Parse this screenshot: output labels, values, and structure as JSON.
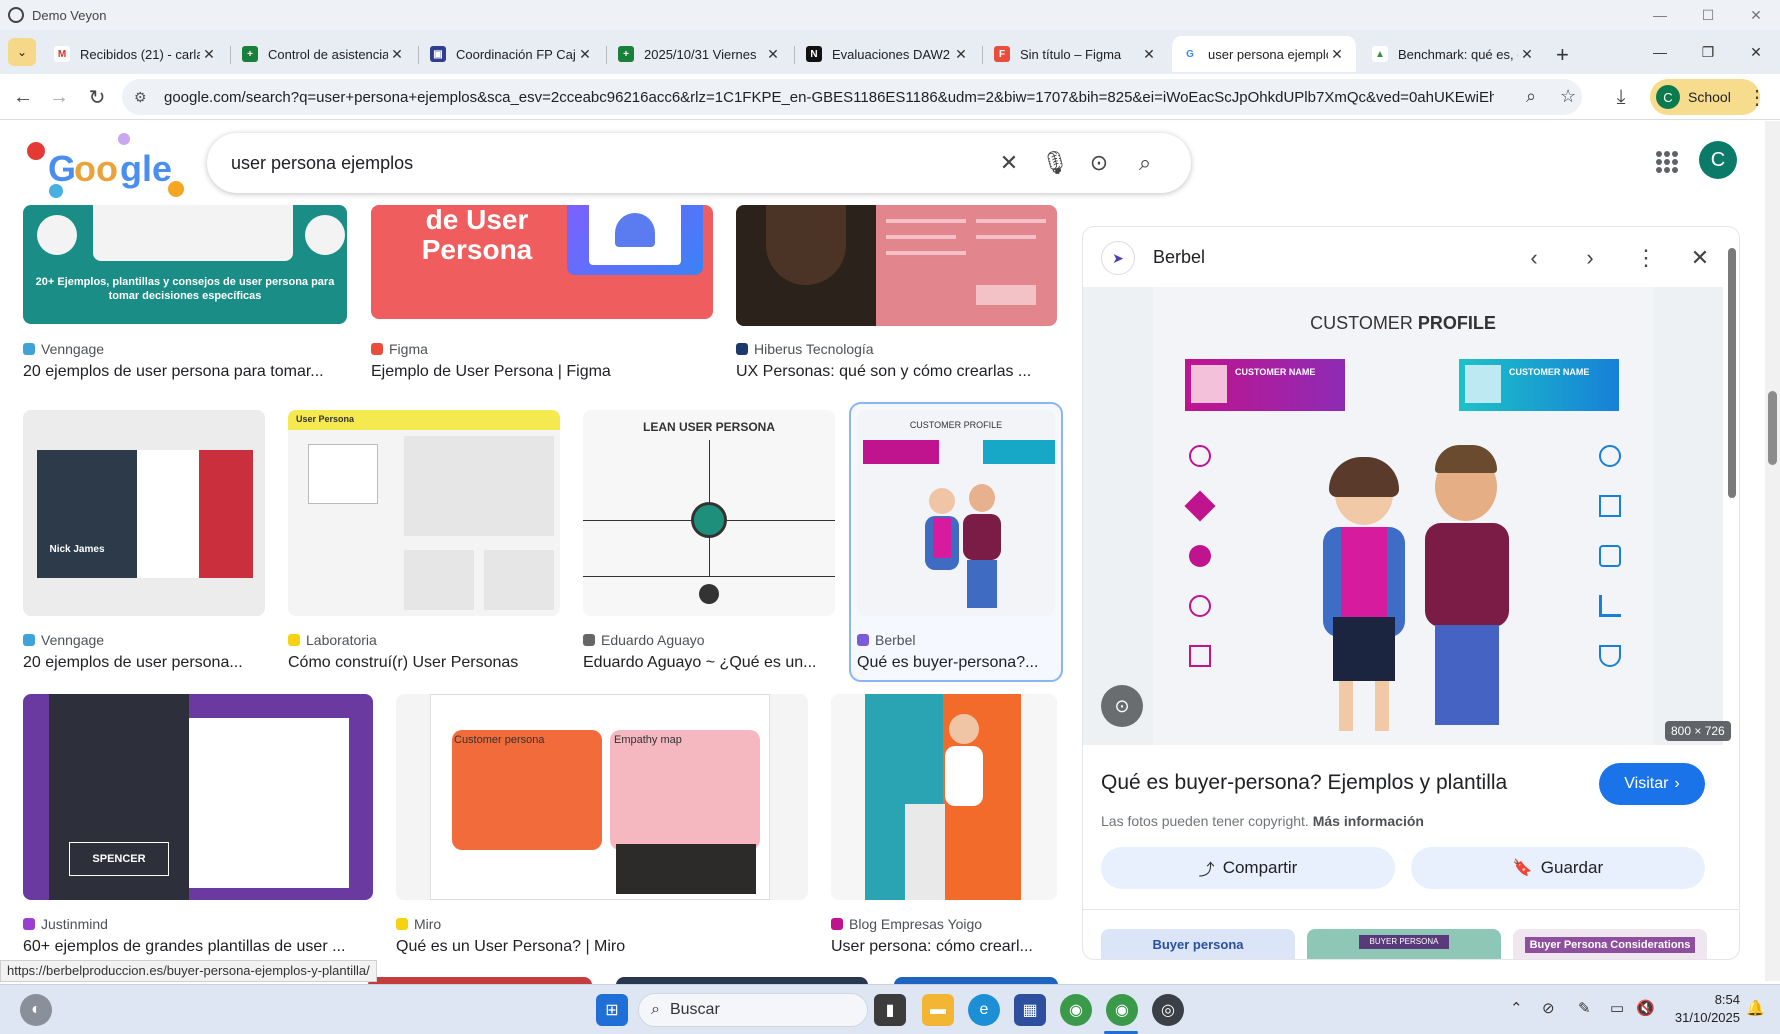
{
  "window": {
    "title": "Demo Veyon"
  },
  "tabs": [
    {
      "label": "Recibidos (21) - carla",
      "icon": "gmail-icon",
      "color": "#d93025",
      "glyph": "M"
    },
    {
      "label": "Control de asistencia",
      "icon": "sheets-icon",
      "color": "#188038",
      "glyph": "+"
    },
    {
      "label": "Coordinación FP Caj",
      "icon": "calendar-icon",
      "color": "#2f3e8f",
      "glyph": "▣"
    },
    {
      "label": "2025/10/31 Viernes",
      "icon": "sheets-icon",
      "color": "#188038",
      "glyph": "+"
    },
    {
      "label": "Evaluaciones DAW2",
      "icon": "notion-icon",
      "color": "#111111",
      "glyph": "N"
    },
    {
      "label": "Sin título – Figma",
      "icon": "figma-icon",
      "color": "#e94e3d",
      "glyph": "F"
    },
    {
      "label": "user persona ejemplos",
      "icon": "google-icon",
      "color": "#4285f4",
      "glyph": "G"
    },
    {
      "label": "Benchmark: qué es, c",
      "icon": "benchmark-icon",
      "color": "#3c8f3c",
      "glyph": "▲"
    }
  ],
  "address": {
    "url": "google.com/search?q=user+persona+ejemplos&sca_esv=2cceabc96216acc6&rlz=1C1FKPE_en-GBES1186ES1186&udm=2&biw=1707&bih=825&ei=iWoEacScJpOhkdUPlb7XmQc&ved=0ahUKEwiEhYqV-s2QA..."
  },
  "profile": {
    "initial": "C",
    "name": "School"
  },
  "search": {
    "query": "user persona ejemplos"
  },
  "account": {
    "initial": "C"
  },
  "results": [
    {
      "source": "Venngage",
      "title": "20 ejemplos de user persona para tomar...",
      "fav": "#3ea4d8",
      "thumb_caption": "20+ Ejemplos, plantillas y consejos de user persona para tomar decisiones específicas"
    },
    {
      "source": "Figma",
      "title": "Ejemplo de User Persona | Figma",
      "fav": "#e94e3d",
      "thumb_caption": "de User Persona"
    },
    {
      "source": "Hiberus Tecnología",
      "title": "UX Personas: qué son y cómo crearlas ...",
      "fav": "#1b3a6b"
    },
    {
      "source": "Venngage",
      "title": "20 ejemplos de user persona...",
      "fav": "#3ea4d8",
      "thumb_caption": "Nick James"
    },
    {
      "source": "Laboratoria",
      "title": "Cómo construí(r) User Personas",
      "fav": "#f5d312",
      "thumb_caption": "User Persona"
    },
    {
      "source": "Eduardo Aguayo",
      "title": "Eduardo Aguayo ~ ¿Qué es un...",
      "fav": "#666666",
      "thumb_caption": "LEAN USER PERSONA"
    },
    {
      "source": "Berbel",
      "title": "Qué es buyer-persona?...",
      "fav": "#7b5cd6",
      "thumb_caption": "CUSTOMER PROFILE"
    },
    {
      "source": "Justinmind",
      "title": "60+ ejemplos de grandes plantillas de user ...",
      "fav": "#9a3fd1",
      "thumb_caption": "SPENCER"
    },
    {
      "source": "Miro",
      "title": "Qué es un User Persona? | Miro",
      "fav": "#f5d312",
      "thumb_caption_a": "Customer persona",
      "thumb_caption_b": "Empathy map"
    },
    {
      "source": "Blog Empresas Yoigo",
      "title": "User persona: cómo crearl...",
      "fav": "#c0138e"
    }
  ],
  "panel": {
    "site": "Berbel",
    "image_title": "CUSTOMER",
    "image_title_bold": "PROFILE",
    "customer_name": "CUSTOMER NAME",
    "dims": "800 × 726",
    "title": "Qué es buyer-persona? Ejemplos y plantilla",
    "visit": "Visitar",
    "copyright": "Las fotos pueden tener copyright.",
    "more_info": "Más información",
    "share": "Compartir",
    "save": "Guardar",
    "related": [
      "Buyer persona",
      "BUYER PERSONA",
      "Buyer Persona Considerations"
    ]
  },
  "status_url": "https://berbelproduccion.es/buyer-persona-ejemplos-y-plantilla/",
  "taskbar": {
    "search_placeholder": "Buscar",
    "time": "8:54",
    "date": "31/10/2025"
  }
}
